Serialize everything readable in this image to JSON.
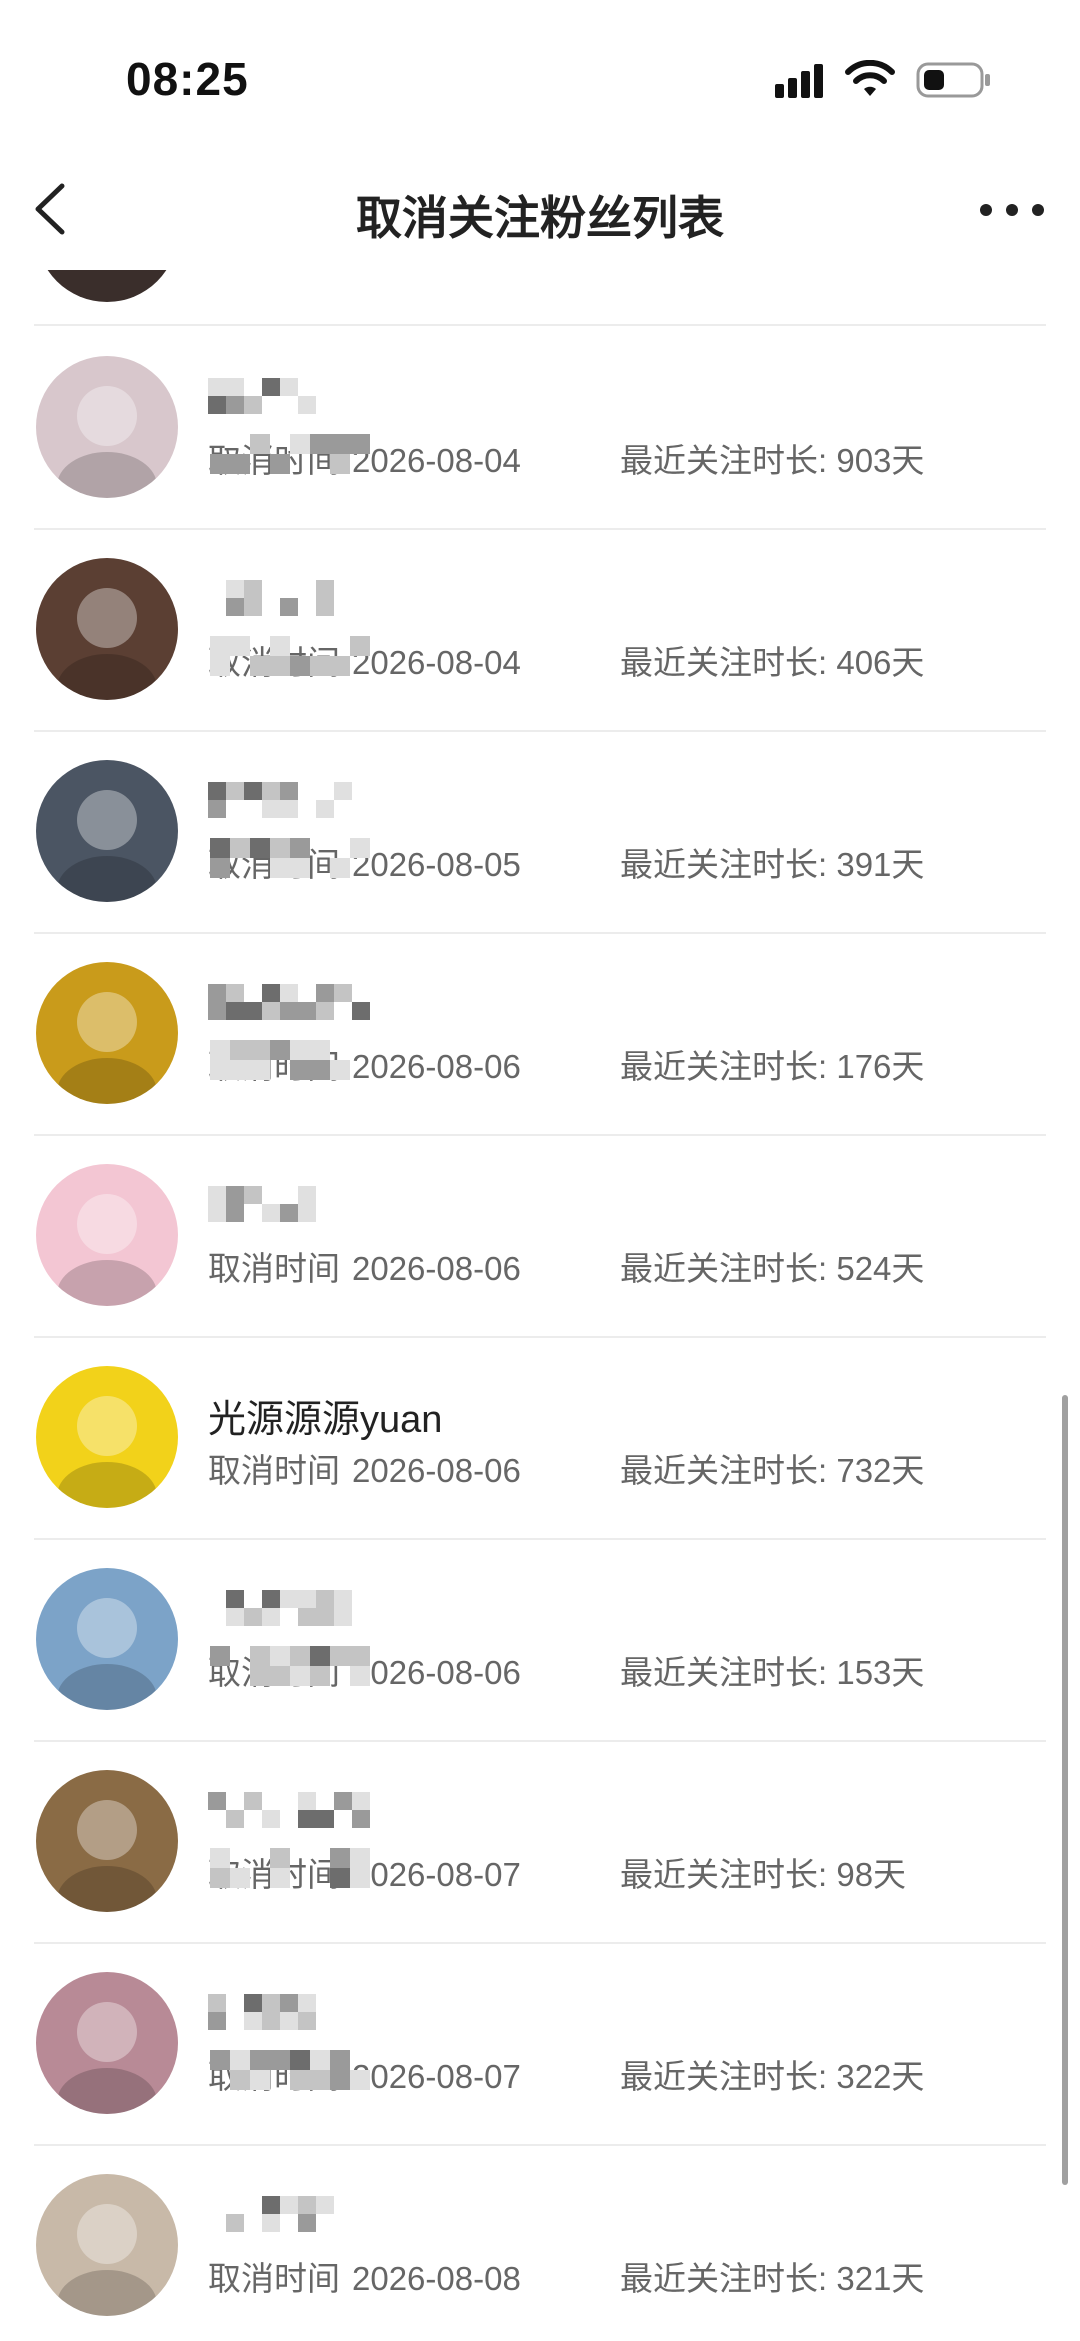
{
  "status_bar": {
    "time": "08:25",
    "icons": [
      "signal-icon",
      "wifi-icon",
      "battery-icon"
    ]
  },
  "nav": {
    "title": "取消关注粉丝列表",
    "back_icon": "chevron-left-icon",
    "more_icon": "more-dots-icon"
  },
  "list": {
    "rows": [
      {
        "name": "",
        "cancel_label": "取消时间",
        "date": "2026-08-04",
        "duration": "最近关注时长: 903天",
        "avatar_color": "#d8c7cc",
        "masked": true
      },
      {
        "name": "",
        "cancel_label": "取消时间",
        "date": "2026-08-04",
        "duration": "最近关注时长: 406天",
        "avatar_color": "#5b3f33",
        "masked": true
      },
      {
        "name": "",
        "cancel_label": "取消时间",
        "date": "2026-08-05",
        "duration": "最近关注时长: 391天",
        "avatar_color": "#4b5563",
        "masked": true
      },
      {
        "name": "",
        "cancel_label": "取消时间",
        "date": "2026-08-06",
        "duration": "最近关注时长: 176天",
        "avatar_color": "#c99b1b",
        "masked": true
      },
      {
        "name": "",
        "cancel_label": "取消时间",
        "date": "2026-08-06",
        "duration": "最近关注时长: 524天",
        "avatar_color": "#f3c6d3",
        "masked": true
      },
      {
        "name": "光源源源yuan",
        "cancel_label": "取消时间",
        "date": "2026-08-06",
        "duration": "最近关注时长: 732天",
        "avatar_color": "#f2d21a",
        "masked": false
      },
      {
        "name": "",
        "cancel_label": "取消时间",
        "date": "2026-08-06",
        "duration": "最近关注时长: 153天",
        "avatar_color": "#7ca3c8",
        "masked": true
      },
      {
        "name": "",
        "cancel_label": "取消时间",
        "date": "2026-08-07",
        "duration": "最近关注时长: 98天",
        "avatar_color": "#8a6b45",
        "masked": true
      },
      {
        "name": "",
        "cancel_label": "取消时间",
        "date": "2026-08-07",
        "duration": "最近关注时长: 322天",
        "avatar_color": "#b88a96",
        "masked": true
      },
      {
        "name": "",
        "cancel_label": "取消时间",
        "date": "2026-08-08",
        "duration": "最近关注时长: 321天",
        "avatar_color": "#c8b9a8",
        "masked": true
      }
    ]
  }
}
